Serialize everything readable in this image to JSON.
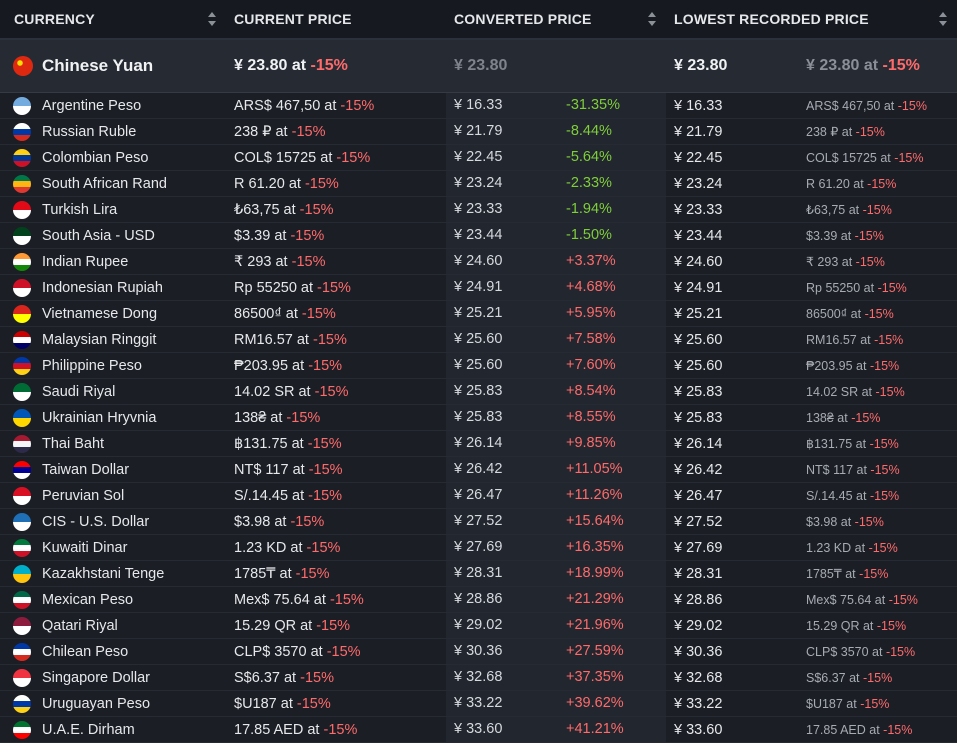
{
  "headers": {
    "currency": "CURRENCY",
    "current_price": "CURRENT PRICE",
    "converted_price": "CONVERTED PRICE",
    "lowest_recorded": "LOWEST RECORDED PRICE"
  },
  "base": {
    "name": "Chinese Yuan",
    "flag_colors": [
      "#de2910",
      "#ffde00"
    ],
    "current_price": "¥ 23.80 at",
    "current_discount": "-15%",
    "converted": "¥ 23.80",
    "lowest": "¥ 23.80",
    "lowest_price": "¥ 23.80 at",
    "lowest_discount": "-15%"
  },
  "rows": [
    {
      "name": "Argentine Peso",
      "flag": [
        "#74acdf",
        "#ffffff"
      ],
      "price": "ARS$ 467,50 at",
      "disc": "-15%",
      "conv": "¥ 16.33",
      "diff": "-31.35%",
      "dir": "down",
      "low": "¥ 16.33",
      "lowp": "ARS$ 467,50 at",
      "lowd": "-15%"
    },
    {
      "name": "Russian Ruble",
      "flag": [
        "#ffffff",
        "#0039a6",
        "#d52b1e"
      ],
      "price": "238 ₽ at",
      "disc": "-15%",
      "conv": "¥ 21.79",
      "diff": "-8.44%",
      "dir": "down",
      "low": "¥ 21.79",
      "lowp": "238 ₽ at",
      "lowd": "-15%"
    },
    {
      "name": "Colombian Peso",
      "flag": [
        "#fcd116",
        "#003893",
        "#ce1126"
      ],
      "price": "COL$ 15725 at",
      "disc": "-15%",
      "conv": "¥ 22.45",
      "diff": "-5.64%",
      "dir": "down",
      "low": "¥ 22.45",
      "lowp": "COL$ 15725 at",
      "lowd": "-15%"
    },
    {
      "name": "South African Rand",
      "flag": [
        "#007749",
        "#ffb612",
        "#de3831"
      ],
      "price": "R 61.20 at",
      "disc": "-15%",
      "conv": "¥ 23.24",
      "diff": "-2.33%",
      "dir": "down",
      "low": "¥ 23.24",
      "lowp": "R 61.20 at",
      "lowd": "-15%"
    },
    {
      "name": "Turkish Lira",
      "flag": [
        "#e30a17",
        "#ffffff"
      ],
      "price": "₺63,75 at",
      "disc": "-15%",
      "conv": "¥ 23.33",
      "diff": "-1.94%",
      "dir": "down",
      "low": "¥ 23.33",
      "lowp": "₺63,75 at",
      "lowd": "-15%"
    },
    {
      "name": "South Asia - USD",
      "flag": [
        "#01411c",
        "#ffffff"
      ],
      "price": "$3.39 at",
      "disc": "-15%",
      "conv": "¥ 23.44",
      "diff": "-1.50%",
      "dir": "down",
      "low": "¥ 23.44",
      "lowp": "$3.39 at",
      "lowd": "-15%"
    },
    {
      "name": "Indian Rupee",
      "flag": [
        "#ff9933",
        "#ffffff",
        "#138808"
      ],
      "price": "₹ 293 at",
      "disc": "-15%",
      "conv": "¥ 24.60",
      "diff": "+3.37%",
      "dir": "up",
      "low": "¥ 24.60",
      "lowp": "₹ 293 at",
      "lowd": "-15%"
    },
    {
      "name": "Indonesian Rupiah",
      "flag": [
        "#ce1126",
        "#ffffff"
      ],
      "price": "Rp 55250 at",
      "disc": "-15%",
      "conv": "¥ 24.91",
      "diff": "+4.68%",
      "dir": "up",
      "low": "¥ 24.91",
      "lowp": "Rp 55250 at",
      "lowd": "-15%"
    },
    {
      "name": "Vietnamese Dong",
      "flag": [
        "#da251d",
        "#ffff00"
      ],
      "price": "86500₫ at",
      "disc": "-15%",
      "conv": "¥ 25.21",
      "diff": "+5.95%",
      "dir": "up",
      "low": "¥ 25.21",
      "lowp": "86500₫ at",
      "lowd": "-15%"
    },
    {
      "name": "Malaysian Ringgit",
      "flag": [
        "#cc0001",
        "#ffffff",
        "#010066"
      ],
      "price": "RM16.57 at",
      "disc": "-15%",
      "conv": "¥ 25.60",
      "diff": "+7.58%",
      "dir": "up",
      "low": "¥ 25.60",
      "lowp": "RM16.57 at",
      "lowd": "-15%"
    },
    {
      "name": "Philippine Peso",
      "flag": [
        "#0038a8",
        "#ce1126",
        "#fcd116"
      ],
      "price": "₱203.95 at",
      "disc": "-15%",
      "conv": "¥ 25.60",
      "diff": "+7.60%",
      "dir": "up",
      "low": "¥ 25.60",
      "lowp": "₱203.95 at",
      "lowd": "-15%"
    },
    {
      "name": "Saudi Riyal",
      "flag": [
        "#006c35",
        "#ffffff"
      ],
      "price": "14.02 SR at",
      "disc": "-15%",
      "conv": "¥ 25.83",
      "diff": "+8.54%",
      "dir": "up",
      "low": "¥ 25.83",
      "lowp": "14.02 SR at",
      "lowd": "-15%"
    },
    {
      "name": "Ukrainian Hryvnia",
      "flag": [
        "#0057b7",
        "#ffd700"
      ],
      "price": "138₴ at",
      "disc": "-15%",
      "conv": "¥ 25.83",
      "diff": "+8.55%",
      "dir": "up",
      "low": "¥ 25.83",
      "lowp": "138₴ at",
      "lowd": "-15%"
    },
    {
      "name": "Thai Baht",
      "flag": [
        "#a51931",
        "#f4f5f8",
        "#2d2a4a"
      ],
      "price": "฿131.75 at",
      "disc": "-15%",
      "conv": "¥ 26.14",
      "diff": "+9.85%",
      "dir": "up",
      "low": "¥ 26.14",
      "lowp": "฿131.75 at",
      "lowd": "-15%"
    },
    {
      "name": "Taiwan Dollar",
      "flag": [
        "#fe0000",
        "#000095",
        "#ffffff"
      ],
      "price": "NT$ 117 at",
      "disc": "-15%",
      "conv": "¥ 26.42",
      "diff": "+11.05%",
      "dir": "up",
      "low": "¥ 26.42",
      "lowp": "NT$ 117 at",
      "lowd": "-15%"
    },
    {
      "name": "Peruvian Sol",
      "flag": [
        "#d91023",
        "#ffffff"
      ],
      "price": "S/.14.45 at",
      "disc": "-15%",
      "conv": "¥ 26.47",
      "diff": "+11.26%",
      "dir": "up",
      "low": "¥ 26.47",
      "lowp": "S/.14.45 at",
      "lowd": "-15%"
    },
    {
      "name": "CIS - U.S. Dollar",
      "flag": [
        "#1e6fb5",
        "#ffffff"
      ],
      "price": "$3.98 at",
      "disc": "-15%",
      "conv": "¥ 27.52",
      "diff": "+15.64%",
      "dir": "up",
      "low": "¥ 27.52",
      "lowp": "$3.98 at",
      "lowd": "-15%"
    },
    {
      "name": "Kuwaiti Dinar",
      "flag": [
        "#007a3d",
        "#ffffff",
        "#ce1126"
      ],
      "price": "1.23 KD at",
      "disc": "-15%",
      "conv": "¥ 27.69",
      "diff": "+16.35%",
      "dir": "up",
      "low": "¥ 27.69",
      "lowp": "1.23 KD at",
      "lowd": "-15%"
    },
    {
      "name": "Kazakhstani Tenge",
      "flag": [
        "#00afca",
        "#fec50c"
      ],
      "price": "1785₸ at",
      "disc": "-15%",
      "conv": "¥ 28.31",
      "diff": "+18.99%",
      "dir": "up",
      "low": "¥ 28.31",
      "lowp": "1785₸ at",
      "lowd": "-15%"
    },
    {
      "name": "Mexican Peso",
      "flag": [
        "#006847",
        "#ffffff",
        "#ce1126"
      ],
      "price": "Mex$ 75.64 at",
      "disc": "-15%",
      "conv": "¥ 28.86",
      "diff": "+21.29%",
      "dir": "up",
      "low": "¥ 28.86",
      "lowp": "Mex$ 75.64 at",
      "lowd": "-15%"
    },
    {
      "name": "Qatari Riyal",
      "flag": [
        "#8d1b3d",
        "#ffffff"
      ],
      "price": "15.29 QR at",
      "disc": "-15%",
      "conv": "¥ 29.02",
      "diff": "+21.96%",
      "dir": "up",
      "low": "¥ 29.02",
      "lowp": "15.29 QR at",
      "lowd": "-15%"
    },
    {
      "name": "Chilean Peso",
      "flag": [
        "#0039a6",
        "#ffffff",
        "#d52b1e"
      ],
      "price": "CLP$ 3570 at",
      "disc": "-15%",
      "conv": "¥ 30.36",
      "diff": "+27.59%",
      "dir": "up",
      "low": "¥ 30.36",
      "lowp": "CLP$ 3570 at",
      "lowd": "-15%"
    },
    {
      "name": "Singapore Dollar",
      "flag": [
        "#ef3340",
        "#ffffff"
      ],
      "price": "S$6.37 at",
      "disc": "-15%",
      "conv": "¥ 32.68",
      "diff": "+37.35%",
      "dir": "up",
      "low": "¥ 32.68",
      "lowp": "S$6.37 at",
      "lowd": "-15%"
    },
    {
      "name": "Uruguayan Peso",
      "flag": [
        "#ffffff",
        "#0038a8",
        "#fcd116"
      ],
      "price": "$U187 at",
      "disc": "-15%",
      "conv": "¥ 33.22",
      "diff": "+39.62%",
      "dir": "up",
      "low": "¥ 33.22",
      "lowp": "$U187 at",
      "lowd": "-15%"
    },
    {
      "name": "U.A.E. Dirham",
      "flag": [
        "#00732f",
        "#ffffff",
        "#ff0000"
      ],
      "price": "17.85 AED at",
      "disc": "-15%",
      "conv": "¥ 33.60",
      "diff": "+41.21%",
      "dir": "up",
      "low": "¥ 33.60",
      "lowp": "17.85 AED at",
      "lowd": "-15%"
    }
  ],
  "colors": {
    "discount": "#ff6b6b",
    "cheaper": "#7fcf3a",
    "pricier": "#ff6b6b",
    "background": "#1b1e25"
  }
}
